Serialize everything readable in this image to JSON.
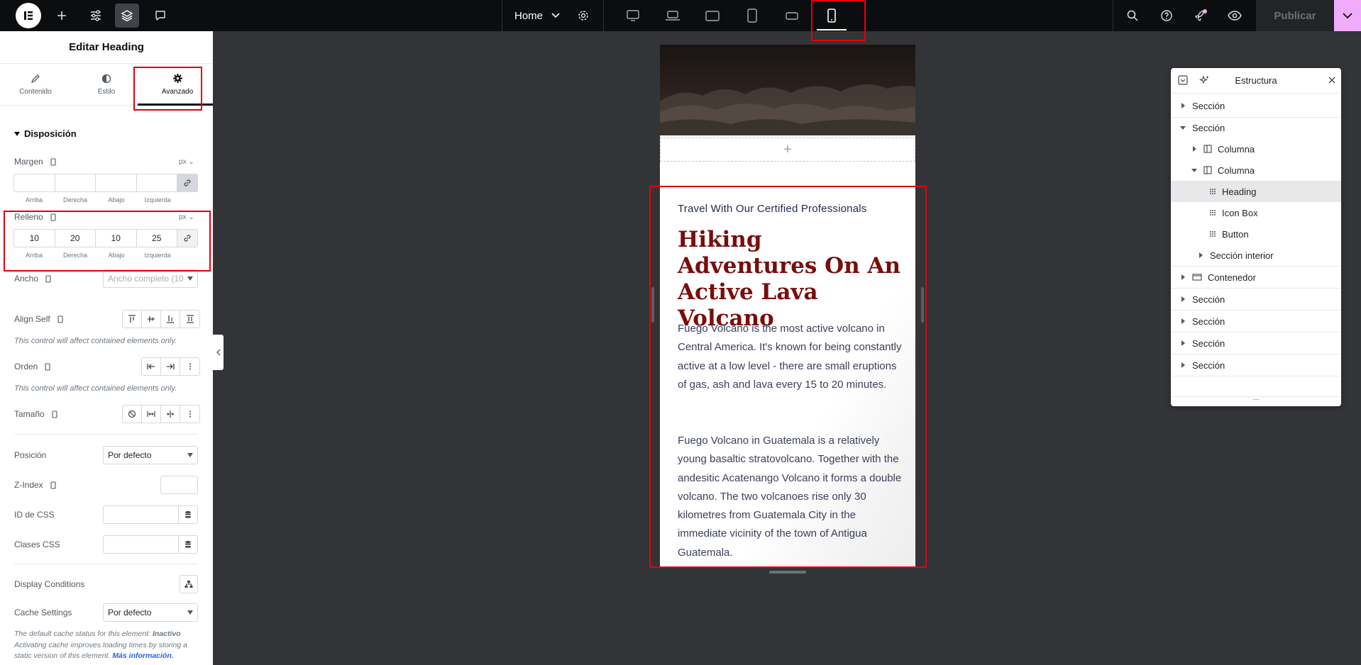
{
  "topbar": {
    "home_label": "Home",
    "publish_label": "Publicar",
    "accent_color": "#f0abfc"
  },
  "panel": {
    "title": "Editar Heading",
    "tabs": [
      {
        "label": "Contenido",
        "icon": "pencil-icon"
      },
      {
        "label": "Estilo",
        "icon": "contrast-icon"
      },
      {
        "label": "Avanzado",
        "icon": "gear-icon"
      }
    ],
    "section_title": "Disposición",
    "margin": {
      "label": "Margen",
      "unit": "px",
      "values": [
        "",
        "",
        "",
        ""
      ],
      "sides": [
        "Arriba",
        "Derecha",
        "Abajo",
        "Izquierda"
      ]
    },
    "padding": {
      "label": "Relleno",
      "unit": "px",
      "values": [
        "10",
        "20",
        "10",
        "25"
      ],
      "sides": [
        "Arriba",
        "Derecha",
        "Abajo",
        "Izquierda"
      ]
    },
    "width": {
      "label": "Ancho",
      "placeholder": "Ancho completo (10"
    },
    "align_self": {
      "label": "Align Self",
      "hint": "This control will affect contained elements only."
    },
    "order": {
      "label": "Orden",
      "hint": "This control will affect contained elements only."
    },
    "size": {
      "label": "Tamaño"
    },
    "position": {
      "label": "Posición",
      "value": "Por defecto"
    },
    "zindex": {
      "label": "Z-Index"
    },
    "css_id": {
      "label": "ID de CSS"
    },
    "css_classes": {
      "label": "Clases CSS"
    },
    "display_conditions": {
      "label": "Display Conditions"
    },
    "cache_settings": {
      "label": "Cache Settings",
      "value": "Por defecto",
      "note_prefix": "The default cache status for this element: ",
      "note_status": "Inactivo",
      "note_line2": "Activating cache improves loading times by storing a",
      "note_line3": "static version of this element. ",
      "note_link": "Más información."
    }
  },
  "canvas": {
    "add_symbol": "+",
    "eyebrow": "Travel With Our Certified Professionals",
    "heading": "Hiking Adventures On An Active Lava Volcano",
    "paragraph1": "Fuego Volcano is the most active volcano in Central America. It's known for being constantly active at a low level - there are small eruptions of gas, ash and lava every 15 to 20 minutes.",
    "paragraph2": "Fuego Volcano in Guatemala is a relatively young basaltic stratovolcano. Together with the andesitic Acatenango Volcano it forms a double volcano. The two volcanoes rise only 30 kilometres from Guatemala City in the immediate vicinity of the town of Antigua Guatemala.",
    "heading_color": "#7a0c0c"
  },
  "structure": {
    "title": "Estructura",
    "more": "...",
    "items": [
      {
        "label": "Sección"
      },
      {
        "label": "Sección"
      },
      {
        "label": "Columna"
      },
      {
        "label": "Columna"
      },
      {
        "label": "Heading"
      },
      {
        "label": "Icon Box"
      },
      {
        "label": "Button"
      },
      {
        "label": "Sección interior"
      },
      {
        "label": "Contenedor"
      },
      {
        "label": "Sección"
      },
      {
        "label": "Sección"
      },
      {
        "label": "Sección"
      },
      {
        "label": "Sección"
      }
    ]
  }
}
